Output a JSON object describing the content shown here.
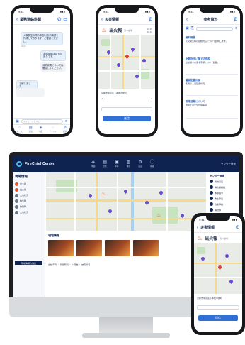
{
  "phone_chat": {
    "header_title": "業務連絡班組",
    "messages": [
      {
        "side": "in",
        "text": "火事発生の際の本部対応手順書を作成しております。ご確認ください。"
      },
      {
        "side": "in",
        "text": "本部配置は以下の通りです。"
      },
      {
        "side": "out",
        "text": "消防設置については確認してください。"
      },
      {
        "side": "in",
        "text": "了解しました。"
      }
    ],
    "input_placeholder": "メッセージを入力",
    "tabs": [
      "ホーム",
      "出動",
      "地図",
      "チャット",
      "設定"
    ]
  },
  "phone_map": {
    "header_title": "災害情報",
    "incident_label": "出火報",
    "incident_sub": "第一出場",
    "info_line": "京都市中京区下本能寺前町",
    "info_value": "2",
    "send_label": "送信"
  },
  "phone_docs": {
    "header_title": "参考資料",
    "items": [
      {
        "title": "資料概要",
        "body": "火災発生時の初動対応について説明します。"
      },
      {
        "title": "出動指令に関する規程",
        "body": "出動指令の発令手順について記載。"
      },
      {
        "title": "署員配置計画",
        "body": "各署の人員配置状況。"
      },
      {
        "title": "現場活動について",
        "body": "現場での安全管理事項。"
      }
    ]
  },
  "desktop": {
    "app_name": "FireChief Center",
    "nav": [
      "地図",
      "出動",
      "車両",
      "本部",
      "設定",
      "情報"
    ],
    "user": "センター管理",
    "side_title": "現場情報",
    "side_items": [
      "出火報",
      "出火報",
      "火災状況",
      "救急隊",
      "救助隊",
      "火災状況"
    ],
    "side_button": "現場情報の追加",
    "lower_title": "現場情報",
    "stats": [
      "出動車両",
      "到着時刻",
      "人員数",
      "被害状況"
    ],
    "right_title": "センター管理",
    "right_rows": [
      "消防署長",
      "消防副署長",
      "本部指令",
      "救急隊長",
      "救助隊長",
      "消防隊"
    ]
  },
  "colors": {
    "navy": "#0f2350",
    "accent": "#2f6fd6",
    "fire": "#e8562a"
  }
}
